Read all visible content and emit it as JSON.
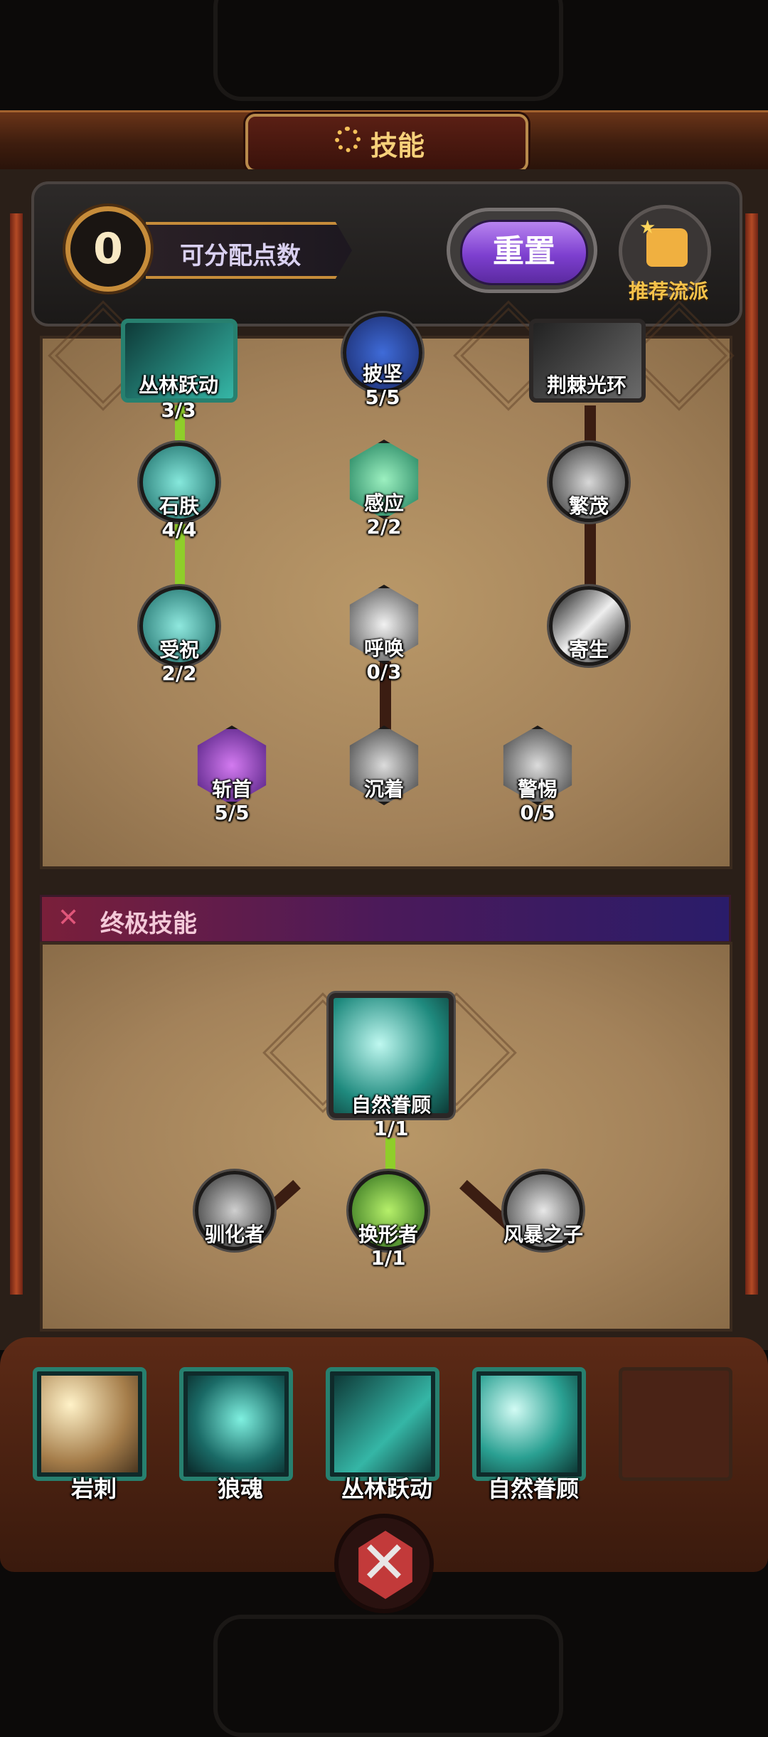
{
  "header": {
    "title": "技能",
    "gear_icon": "gear-icon"
  },
  "points": {
    "value": "0",
    "label": "可分配点数"
  },
  "reset": {
    "label": "重置"
  },
  "recommend": {
    "label": "推荐流派",
    "icon": "thumbs-up-icon"
  },
  "tree": {
    "top_row": [
      {
        "name": "丛林跃动",
        "count": "3/3"
      },
      {
        "name": "披坚",
        "count": "5/5"
      },
      {
        "name": "荆棘光环",
        "count": ""
      }
    ],
    "row2": [
      {
        "name": "石肤",
        "count": "4/4"
      },
      {
        "name": "感应",
        "count": "2/2"
      },
      {
        "name": "繁茂",
        "count": ""
      }
    ],
    "row3": [
      {
        "name": "受祝",
        "count": "2/2"
      },
      {
        "name": "呼唤",
        "count": "0/3"
      },
      {
        "name": "寄生",
        "count": ""
      }
    ],
    "row4": [
      {
        "name": "斩首",
        "count": "5/5"
      },
      {
        "name": "沉着",
        "count": ""
      },
      {
        "name": "警惕",
        "count": "0/5"
      }
    ]
  },
  "ultimate": {
    "title": "终极技能",
    "main": {
      "name": "自然眷顾",
      "count": "1/1"
    },
    "subs": [
      {
        "name": "驯化者",
        "count": ""
      },
      {
        "name": "换形者",
        "count": "1/1"
      },
      {
        "name": "风暴之子",
        "count": ""
      }
    ]
  },
  "equipped": [
    {
      "name": "岩刺"
    },
    {
      "name": "狼魂"
    },
    {
      "name": "丛林跃动"
    },
    {
      "name": "自然眷顾"
    }
  ],
  "close": {
    "glyph": "✕"
  }
}
